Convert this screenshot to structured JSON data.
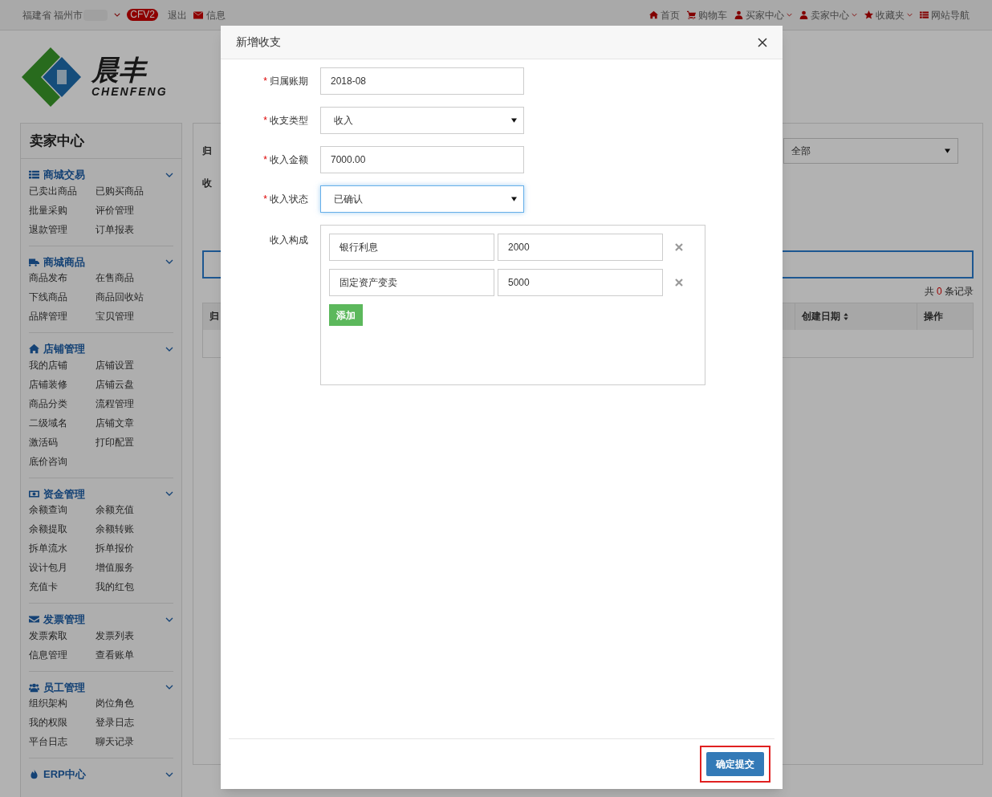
{
  "top_bar": {
    "location": "福建省 福州市",
    "badge": "CFV2",
    "logout": "退出",
    "messages": "信息",
    "links": [
      {
        "label": "首页",
        "caret": false
      },
      {
        "label": "购物车",
        "caret": false
      },
      {
        "label": "买家中心",
        "caret": true
      },
      {
        "label": "卖家中心",
        "caret": true
      },
      {
        "label": "收藏夹",
        "caret": true
      },
      {
        "label": "网站导航",
        "caret": false
      }
    ]
  },
  "logo": {
    "name": "晨丰",
    "subtitle": "CHENFENG"
  },
  "sidebar": {
    "title": "卖家中心",
    "groups": [
      {
        "title": "商城交易",
        "items": [
          "已卖出商品",
          "已购买商品",
          "批量采购",
          "评价管理",
          "退款管理",
          "订单报表"
        ]
      },
      {
        "title": "商城商品",
        "items": [
          "商品发布",
          "在售商品",
          "下线商品",
          "商品回收站",
          "品牌管理",
          "宝贝管理"
        ]
      },
      {
        "title": "店铺管理",
        "items": [
          "我的店铺",
          "店铺设置",
          "店铺装修",
          "店铺云盘",
          "商品分类",
          "流程管理",
          "二级域名",
          "店铺文章",
          "激活码",
          "打印配置",
          "底价咨询"
        ]
      },
      {
        "title": "资金管理",
        "items": [
          "余额查询",
          "余额充值",
          "余额提取",
          "余额转账",
          "拆单流水",
          "拆单报价",
          "设计包月",
          "增值服务",
          "充值卡",
          "我的红包"
        ]
      },
      {
        "title": "发票管理",
        "items": [
          "发票索取",
          "发票列表",
          "信息管理",
          "查看账单"
        ]
      },
      {
        "title": "员工管理",
        "items": [
          "组织架构",
          "岗位角色",
          "我的权限",
          "登录日志",
          "平台日志",
          "聊天记录"
        ]
      },
      {
        "title": "ERP中心"
      }
    ]
  },
  "main": {
    "filter_labels": [
      "归",
      "收"
    ],
    "filter_select": "全部",
    "record_count": {
      "prefix": "共",
      "count": "0",
      "suffix": "条记录"
    },
    "table": {
      "columns": [
        "归",
        "创建日期",
        "操作"
      ]
    }
  },
  "dialog": {
    "title": "新增收支",
    "required_mark": "*",
    "fields": [
      {
        "kind": "input",
        "required": true,
        "label": "归属账期",
        "value": "2018-08",
        "focused": false
      },
      {
        "kind": "select",
        "required": true,
        "label": "收支类型",
        "value": "收入",
        "focused": false
      },
      {
        "kind": "input",
        "required": true,
        "label": "收入金额",
        "value": "7000.00",
        "focused": false
      },
      {
        "kind": "select",
        "required": true,
        "label": "收入状态",
        "value": "已确认",
        "focused": true
      }
    ],
    "composition": {
      "label": "收入构成",
      "rows": [
        {
          "name": "银行利息",
          "amount": "2000"
        },
        {
          "name": "固定资产变卖",
          "amount": "5000"
        }
      ],
      "add_button": "添加"
    },
    "submit": "确定提交"
  }
}
